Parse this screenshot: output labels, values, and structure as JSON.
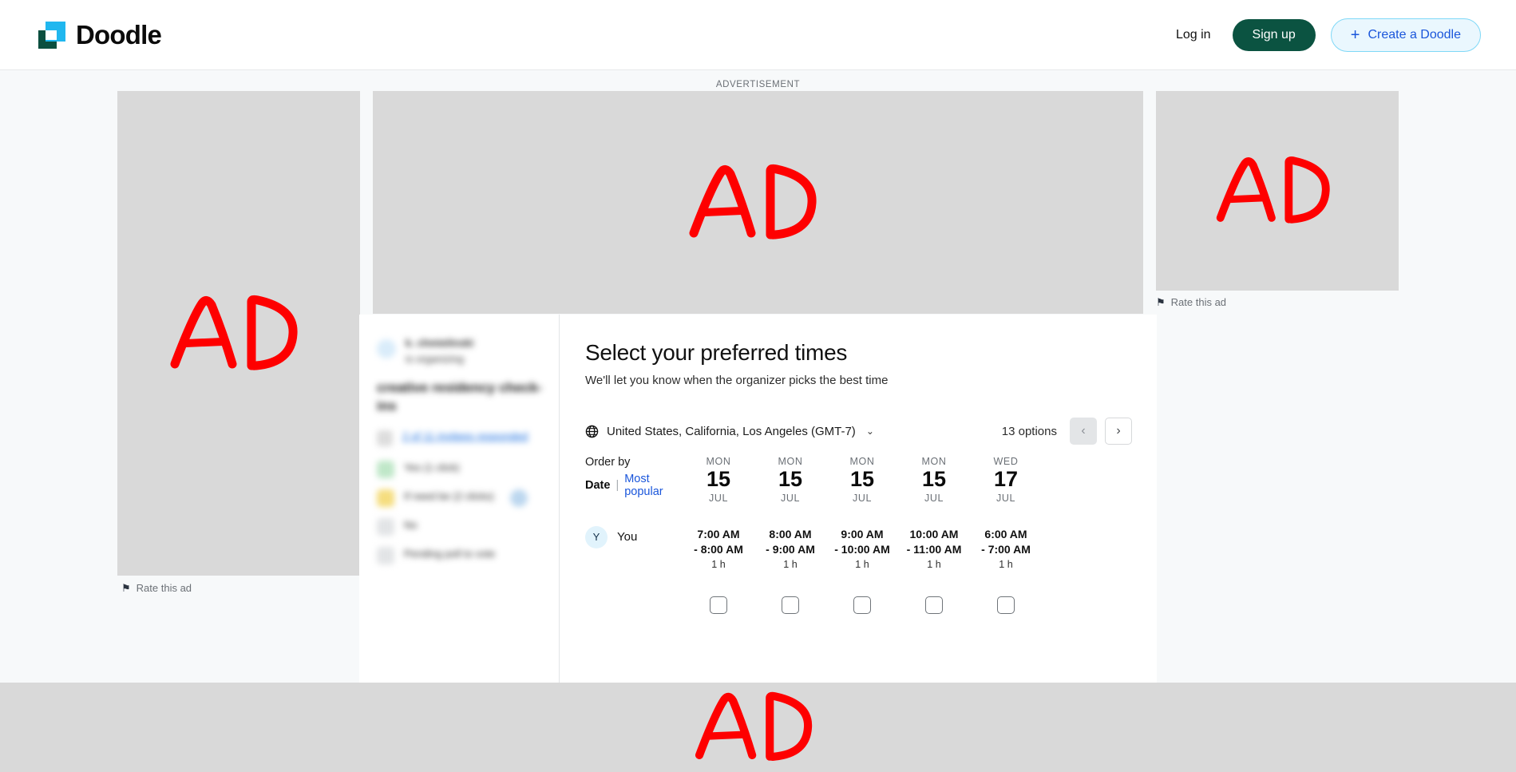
{
  "header": {
    "brand": "Doodle",
    "login_label": "Log in",
    "signup_label": "Sign up",
    "create_label": "Create a Doodle",
    "plus_icon": "+"
  },
  "ads": {
    "label": "ADVERTISEMENT",
    "placeholder_text": "AD",
    "rate_label": "Rate this ad",
    "flag_icon": "⚑",
    "box_color": "#d9d9d9",
    "scribble_color": "#fe0000"
  },
  "poll_sidebar": {
    "organizer_name": "k. chmielinski",
    "organizer_sub": "is organizing",
    "poll_title": "creative residency check-ins",
    "responded": "2 of 11 invitees responded",
    "legend": [
      {
        "label": "Yes (1 click)"
      },
      {
        "label": "If need be (2 clicks)"
      },
      {
        "label": "No"
      },
      {
        "label": "Pending poll to vote"
      }
    ]
  },
  "main": {
    "title": "Select your preferred times",
    "subtitle": "We'll let you know when the organizer picks the best time",
    "timezone": "United States, California, Los Angeles (GMT-7)",
    "globe_icon": "globe-icon",
    "caret_icon": "⌄",
    "options_count": "13 options",
    "prev_icon": "‹",
    "next_icon": "›",
    "order_by_label": "Order by",
    "order_date": "Date",
    "order_separator": "|",
    "order_popular": "Most popular",
    "participant": {
      "initial": "Y",
      "name": "You"
    },
    "columns": [
      {
        "dow": "MON",
        "day": "15",
        "month": "JUL",
        "start": "7:00 AM",
        "end": "- 8:00 AM",
        "duration": "1 h",
        "checked": false
      },
      {
        "dow": "MON",
        "day": "15",
        "month": "JUL",
        "start": "8:00 AM",
        "end": "- 9:00 AM",
        "duration": "1 h",
        "checked": false
      },
      {
        "dow": "MON",
        "day": "15",
        "month": "JUL",
        "start": "9:00 AM",
        "end": "- 10:00 AM",
        "duration": "1 h",
        "checked": false
      },
      {
        "dow": "MON",
        "day": "15",
        "month": "JUL",
        "start": "10:00 AM",
        "end": "- 11:00 AM",
        "duration": "1 h",
        "checked": false
      },
      {
        "dow": "WED",
        "day": "17",
        "month": "JUL",
        "start": "6:00 AM",
        "end": "- 7:00 AM",
        "duration": "1 h",
        "checked": false
      }
    ]
  },
  "colors": {
    "brand_teal": "#0b4f3f",
    "brand_blue": "#20b7ef",
    "signup_green": "#0b5341",
    "link_blue": "#1a56db",
    "page_bg": "#f7f9fa"
  }
}
